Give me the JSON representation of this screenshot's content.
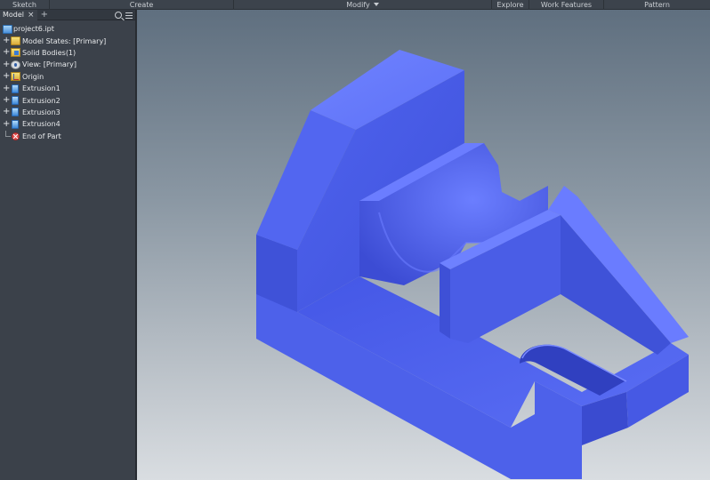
{
  "ribbon": {
    "tabs": [
      {
        "label": "Sketch"
      },
      {
        "label": "Create"
      },
      {
        "label": "Modify"
      },
      {
        "label": "Explore"
      },
      {
        "label": "Work Features"
      },
      {
        "label": "Pattern"
      }
    ]
  },
  "browser": {
    "tab_label": "Model",
    "close_glyph": "×",
    "add_glyph": "+",
    "root": {
      "label": "project6.ipt",
      "icon": "part-icon"
    },
    "items": [
      {
        "label": "Model States: [Primary]",
        "icon": "folder-icon"
      },
      {
        "label": "Solid Bodies(1)",
        "icon": "solid-bodies-icon"
      },
      {
        "label": "View: [Primary]",
        "icon": "view-icon"
      },
      {
        "label": "Origin",
        "icon": "origin-icon"
      },
      {
        "label": "Extrusion1",
        "icon": "extrusion-icon"
      },
      {
        "label": "Extrusion2",
        "icon": "extrusion-icon"
      },
      {
        "label": "Extrusion3",
        "icon": "extrusion-icon"
      },
      {
        "label": "Extrusion4",
        "icon": "extrusion-icon"
      }
    ],
    "end": {
      "label": "End of Part",
      "icon": "end-of-part-icon"
    },
    "expand_glyph": "+"
  },
  "colors": {
    "model_blue": "#5a6ff5",
    "model_top": "#6b7dff",
    "model_dark": "#3f4fd6"
  }
}
